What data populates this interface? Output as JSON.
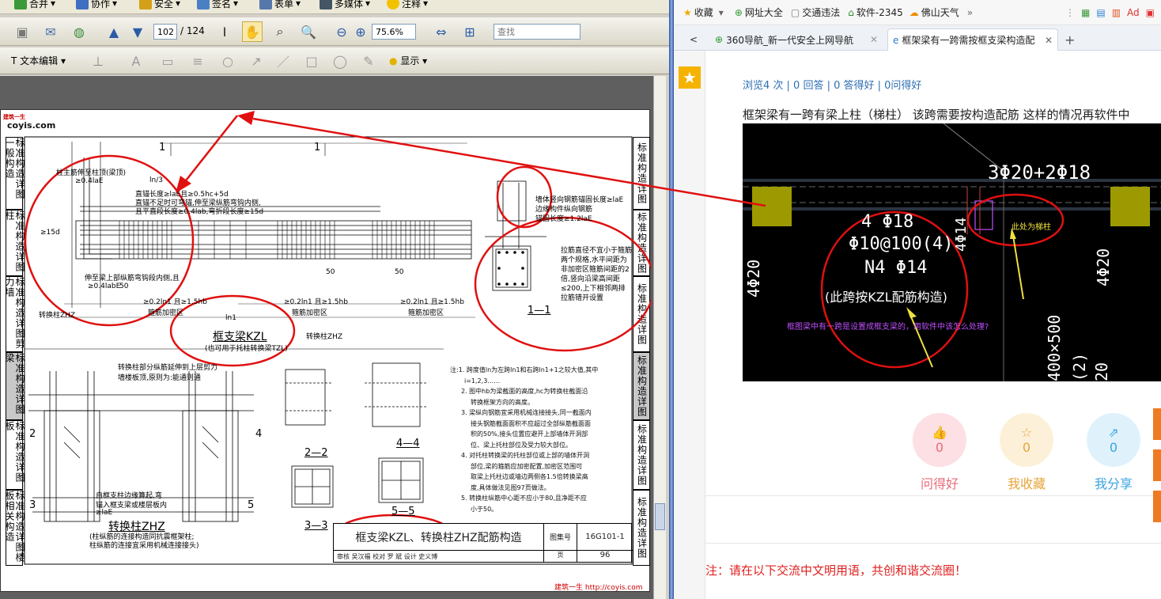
{
  "pdf": {
    "menu": [
      {
        "label": "合并",
        "icon": "merge-icon",
        "color": "#3a9a3a"
      },
      {
        "label": "协作",
        "icon": "collaborate-icon",
        "color": "#3f6fc0"
      },
      {
        "label": "安全",
        "icon": "lock-icon",
        "color": "#d4a017"
      },
      {
        "label": "签名",
        "icon": "pen-icon",
        "color": "#4a7fc4"
      },
      {
        "label": "表单",
        "icon": "form-icon",
        "color": "#5577aa"
      },
      {
        "label": "多媒体",
        "icon": "film-icon",
        "color": "#445566"
      },
      {
        "label": "注释",
        "icon": "comment-icon",
        "color": "#f2c200"
      }
    ],
    "page_current": "102",
    "page_total": "/ 124",
    "zoom": "75.6%",
    "search_placeholder": "查找",
    "text_edit_label": "文本编辑",
    "show_label": "显示",
    "page": {
      "logo_small": "建筑一生",
      "logo": "coyis.com",
      "side_labels": [
        "标准构造详图一般构造",
        "标准构造详图柱",
        "标准构造详图剪力墙",
        "标准构造详图梁",
        "标准构造详图板",
        "标准构造详图楼板相关构造"
      ],
      "right_labels": [
        "标准构造详图",
        "标准构造详图",
        "标准构造详图",
        "标准构造详图",
        "标准构造详图",
        "标准构造详图"
      ],
      "drawing_texts": [
        "柱主筋伸至柱顶(梁顶)",
        "伸至梁上部纵筋弯钩段内侧,且",
        "≥0.4laE",
        "ln/3",
        "直锚长度≥laE且≥0.5hc+5d",
        "直锚不足时可弯锚,伸至梁纵筋弯钩内侧,",
        "且平直段长度≥0.4lab,弯折段长度≥15d",
        "≥15d",
        "伸至梁上部纵筋弯钩段内侧,且",
        "≥0.4labE",
        "50",
        "≥0.2ln1 且≥1.5hb",
        "箍筋加密区",
        "转换柱ZHZ",
        "lbl",
        "ln1",
        "lbl",
        "墙体竖向钢筋锚固长度≥laE",
        "边缘构件纵向钢筋",
        "锚固长度≥1.2laE",
        "拉筋直径不宜小于箍筋",
        "两个规格,水平间距为",
        "非加密区箍筋间距的2",
        "倍,竖向沿梁高间距",
        "≤200,上下相邻两排",
        "拉筋错开设置",
        "转换柱部分纵筋延伸到上层剪力",
        "墙楼板顶,原则为:能通则通",
        "≥0.5 laE",
        "自框支柱边缘算起,弯",
        "锚入框支梁或楼层板内",
        "≥laE",
        "转换柱ZHZ"
      ],
      "section_labels": [
        "1",
        "1",
        "1—1",
        "2",
        "2",
        "3",
        "3",
        "4",
        "4",
        "5",
        "5",
        "2—2",
        "3—3",
        "4—4",
        "5—5"
      ],
      "kzl_title": "框支梁KZL",
      "kzl_subtitle": "(也可用于托柱转换梁TZL)",
      "zhz_title": "转换柱ZHZ",
      "zhz_subtitle": "(柱纵筋的连接构造同抗震框架柱;\n柱纵筋的连接宜采用机械连接接头)",
      "notes": [
        "注:1. 跨度值ln为左跨ln1和右跨ln1+1之较大值,其中",
        "i=1,2,3……",
        "2. 图中hb为梁截面的高度,hc为转换柱截面沿",
        "转换框架方向的高度。",
        "3. 梁纵向钢筋宜采用机械连接接头,同一截面内",
        "接头钢筋截面面积不应超过全部纵筋截面面",
        "积的50%,接头位置应避开上部墙体开洞部",
        "位、梁上托柱部位及受力较大部位。",
        "4. 对托柱转换梁的托柱部位或上部的墙体开洞",
        "部位,梁的箍筋应加密配置,加密区范围可",
        "取梁上托柱边或墙边两侧各1.5倍转换梁高",
        "度,具体做法见图97页做法。",
        "5. 转换柱纵筋中心距不应小于80,且净距不应",
        "小于50。"
      ],
      "title_block": {
        "title": "框支梁KZL、转换柱ZHZ配筋构造",
        "atlas_label": "图集号",
        "atlas_no": "16G101-1",
        "review_row": "审核 吴汉福  校对 罗 斌  设计 史义博",
        "page_label": "页",
        "page_no": "96"
      },
      "footer_url": "建筑一生 http://coyis.com"
    }
  },
  "browser": {
    "bookmarks": [
      {
        "label": "收藏",
        "icon": "star-icon"
      },
      {
        "label": "网址大全",
        "icon": "site-icon"
      },
      {
        "label": "交通违法",
        "icon": "page-icon"
      },
      {
        "label": "软件-2345",
        "icon": "software-icon"
      },
      {
        "label": "佛山天气",
        "icon": "weather-icon"
      }
    ],
    "tabs": [
      {
        "label": "360导航_新一代安全上网导航"
      },
      {
        "label": "框架梁有一跨需按框支梁构造配"
      }
    ],
    "stats": "浏览4 次 | 0 回答 | 0 答得好 | 0问得好",
    "question": "框架梁有一跨有梁上柱（梯柱） 该跨需要按构造配筋 这样的情况再软件中",
    "cad": {
      "top_rebar": "3Φ20+2Φ18",
      "mid_rebar_1": "4 Φ18",
      "mid_rebar_2": "Φ10@100(4)",
      "mid_rebar_3": "N4 Φ14",
      "mid_note": "(此跨按KZL配筋构造)",
      "left_col": "4Φ20",
      "right_col": "4Φ20",
      "vert_label": "4Φ14",
      "tiezhu": "此处为梯柱",
      "question_note": "框图梁中有一跨是设置成框支梁的，用软件中该怎么处理?",
      "dim": "400×500",
      "dim2": "(2)",
      "dim3": "20"
    },
    "actions": [
      {
        "count": "0",
        "label": "问得好",
        "color": "#e86b7a",
        "bg": "#fde0e4",
        "icon": "thumb-icon"
      },
      {
        "count": "0",
        "label": "我收藏",
        "color": "#e6a53a",
        "bg": "#fdf0d8",
        "icon": "star-outline-icon"
      },
      {
        "count": "0",
        "label": "我分享",
        "color": "#3aa3e0",
        "bg": "#dff2fc",
        "icon": "share-icon"
      }
    ],
    "notice": "注：请在以下交流中文明用语，共创和谐交流圈！"
  }
}
